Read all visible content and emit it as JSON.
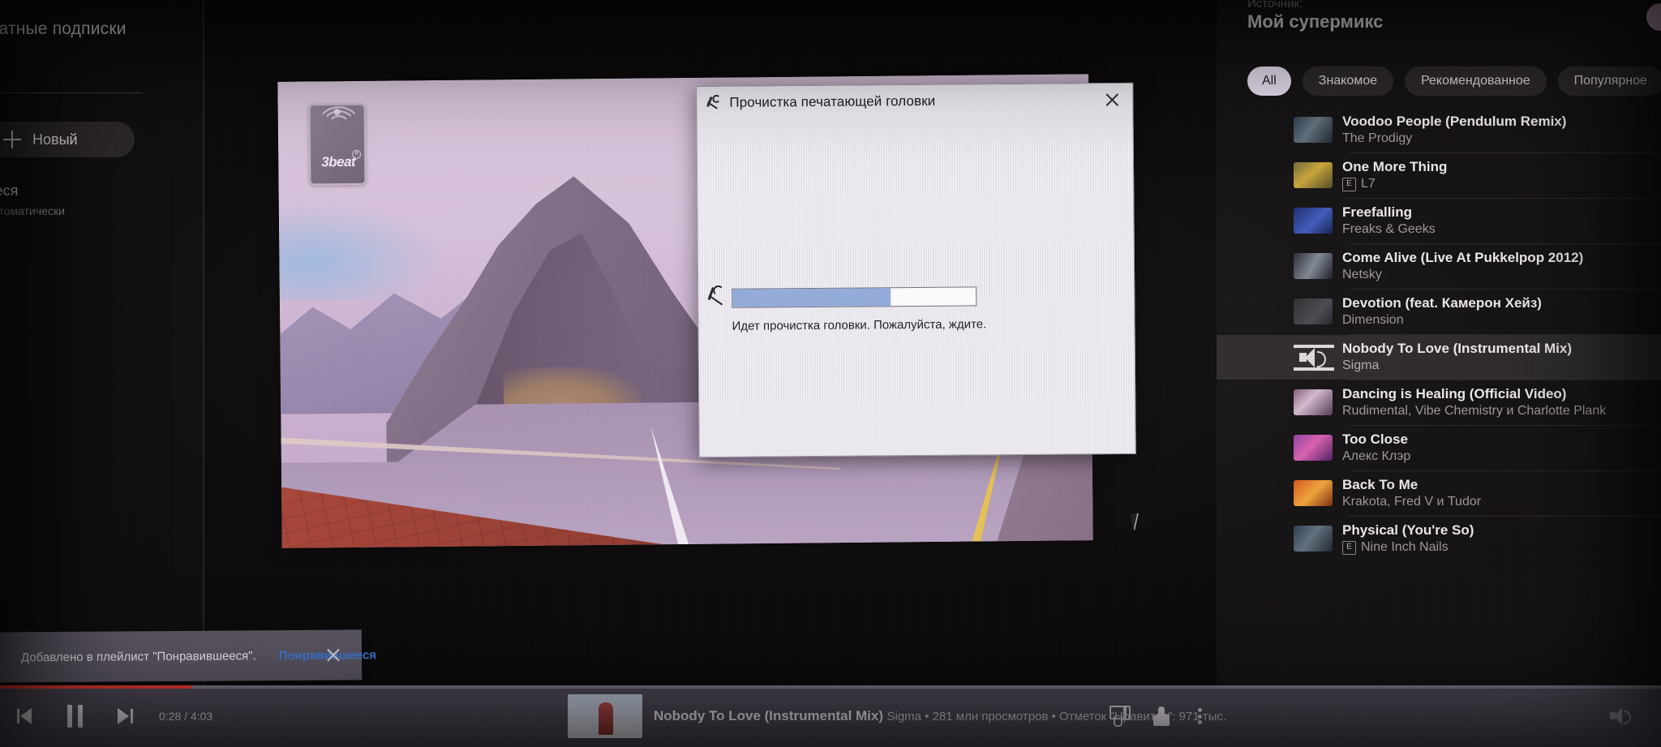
{
  "sidebar": {
    "section_header": "латные подписки",
    "new_button": "Новый",
    "playlist_title": "вившееся",
    "playlist_subtitle": "дан автоматически"
  },
  "video": {
    "logo_text": "3beat",
    "logo_mark": "registered-mark"
  },
  "dialog": {
    "title": "Прочистка печатающей головки",
    "icon": "print-head-nozzle-icon",
    "close_icon": "close-icon",
    "status_text": "Идет прочистка головки. Пожалуйста, ждите.",
    "progress_percent": 65,
    "progress_fill_color": "#8fa8d8",
    "background_color": "#ece9ef"
  },
  "queue": {
    "source_label": "Источник:",
    "title": "Мой супермикс",
    "chips": [
      {
        "label": "All",
        "active": true
      },
      {
        "label": "Знакомое",
        "active": false
      },
      {
        "label": "Рекомендованное",
        "active": false
      },
      {
        "label": "Популярное",
        "active": false
      }
    ],
    "items": [
      {
        "title": "Voodoo People (Pendulum Remix)",
        "artist": "The Prodigy",
        "explicit": false,
        "selected": false
      },
      {
        "title": "One More Thing",
        "artist": "L7",
        "explicit": true,
        "selected": false
      },
      {
        "title": "Freefalling",
        "artist": "Freaks & Geeks",
        "explicit": false,
        "selected": false
      },
      {
        "title": "Come Alive (Live At Pukkelpop 2012)",
        "artist": "Netsky",
        "explicit": false,
        "selected": false
      },
      {
        "title": "Devotion (feat. Камерон Хейз)",
        "artist": "Dimension",
        "explicit": false,
        "selected": false
      },
      {
        "title": "Nobody To Love (Instrumental Mix)",
        "artist": "Sigma",
        "explicit": false,
        "selected": true
      },
      {
        "title": "Dancing is Healing (Official Video)",
        "artist": "Rudimental, Vibe Chemistry и Charlotte Plank",
        "explicit": false,
        "selected": false
      },
      {
        "title": "Too Close",
        "artist": "Алекс Клэр",
        "explicit": false,
        "selected": false
      },
      {
        "title": "Back To Me",
        "artist": "Krakota, Fred V и Tudor",
        "explicit": false,
        "selected": false
      },
      {
        "title": "Physical (You're So)",
        "artist": "Nine Inch Nails",
        "explicit": true,
        "selected": false
      }
    ],
    "explicit_badge": "E"
  },
  "toast": {
    "message": "Добавлено в плейлист \"Понравившееся\".",
    "link": "Понравившееся",
    "link_color": "#3b7ddd",
    "close_icon": "close-icon"
  },
  "player": {
    "prev_icon": "previous-track-icon",
    "pause_icon": "pause-icon",
    "next_icon": "next-track-icon",
    "time": "0:28 / 4:03",
    "progress_percent": 11.5,
    "progress_color": "#e8392f",
    "now_playing_title": "Nobody To Love (Instrumental Mix)",
    "now_playing_subtitle": "Sigma • 281 млн просмотров • Отметок \"Нравится\": 971 тыс.",
    "dislike_icon": "thumbs-down-icon",
    "like_icon": "thumbs-up-icon",
    "menu_icon": "kebab-menu-icon",
    "volume_icon": "volume-icon"
  }
}
